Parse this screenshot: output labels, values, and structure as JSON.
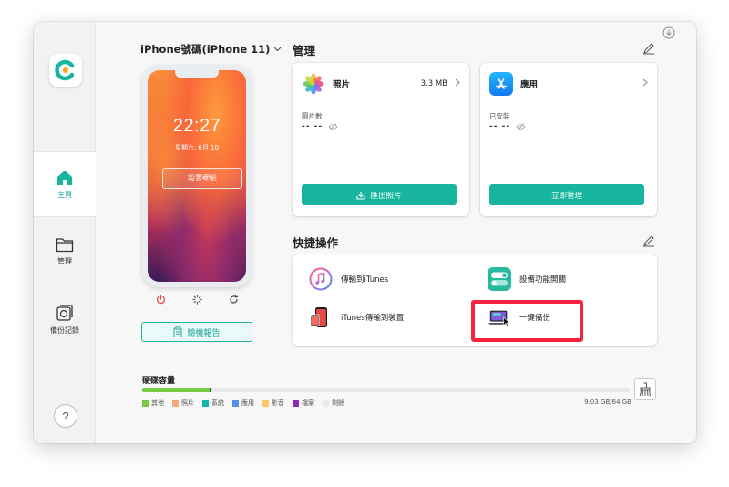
{
  "device": {
    "title": "iPhone號碼(iPhone 11)",
    "time": "22:27",
    "date": "星期六, 6月 10",
    "wallpaper_btn": "設置壁紙",
    "report_btn": "驗機報告"
  },
  "sidebar": {
    "items": [
      {
        "label": "主頁",
        "icon": "home-icon"
      },
      {
        "label": "管理",
        "icon": "folder-icon"
      },
      {
        "label": "備份記錄",
        "icon": "backup-icon"
      }
    ],
    "help": "?"
  },
  "manage": {
    "title": "管理",
    "photos": {
      "name": "照片",
      "size": "3.3 MB",
      "stat_label": "圖片數",
      "stat_value": "-- --",
      "button": "匯出照片"
    },
    "apps": {
      "name": "應用",
      "stat_label": "已安裝",
      "stat_value": "-- --",
      "button": "立即管理"
    }
  },
  "quick": {
    "title": "快捷操作",
    "actions": [
      {
        "label": "傳輸到iTunes"
      },
      {
        "label": "設備功能開關"
      },
      {
        "label": "iTunes傳輸到裝置"
      },
      {
        "label": "一鍵備份"
      }
    ]
  },
  "storage": {
    "title": "硬碟容量",
    "value": "9.03 GB/64 GB",
    "used_fraction": 0.141,
    "legend": [
      {
        "label": "其他",
        "color": "#7ac943"
      },
      {
        "label": "照片",
        "color": "#f5a97f"
      },
      {
        "label": "系統",
        "color": "#13b5a6"
      },
      {
        "label": "應用",
        "color": "#5b8def"
      },
      {
        "label": "影音",
        "color": "#f7c96b"
      },
      {
        "label": "檔案",
        "color": "#8a2bb5"
      },
      {
        "label": "剩餘",
        "color": "#e8ecef"
      }
    ]
  },
  "colors": {
    "accent": "#17b59f",
    "highlight": "#f5233f"
  }
}
